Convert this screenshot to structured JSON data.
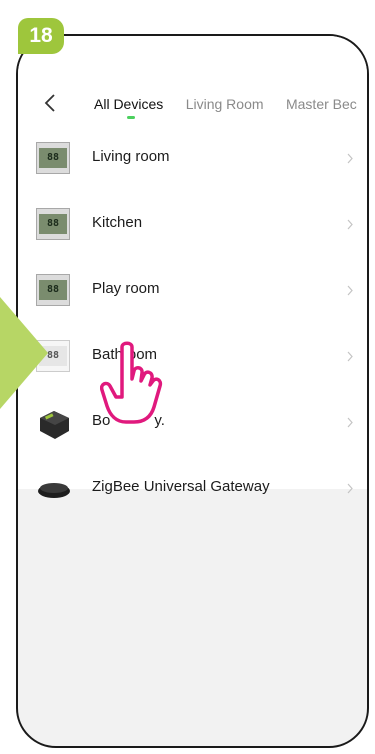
{
  "step": {
    "number": "18"
  },
  "header": {
    "back_icon": "chevron-left-icon",
    "tabs": [
      {
        "label": "All Devices",
        "active": true
      },
      {
        "label": "Living Room",
        "active": false
      },
      {
        "label": "Master Bec",
        "active": false
      }
    ]
  },
  "devices": [
    {
      "name": "Living room",
      "icon": "thermostat-lcd-icon"
    },
    {
      "name": "Kitchen",
      "icon": "thermostat-lcd-icon"
    },
    {
      "name": "Play room",
      "icon": "thermostat-lcd-icon"
    },
    {
      "name": "Bathroom",
      "icon": "thermostat-white-icon"
    },
    {
      "name": "Bo",
      "name_suffix": "y.",
      "icon": "module-box-icon"
    },
    {
      "name": "ZigBee Universal Gateway",
      "icon": "gateway-icon"
    }
  ],
  "colors": {
    "badge": "#9ec63c",
    "tab_indicator": "#4cd05e",
    "pointer_hand": "#e0197d",
    "background": "#f2f2f2"
  }
}
